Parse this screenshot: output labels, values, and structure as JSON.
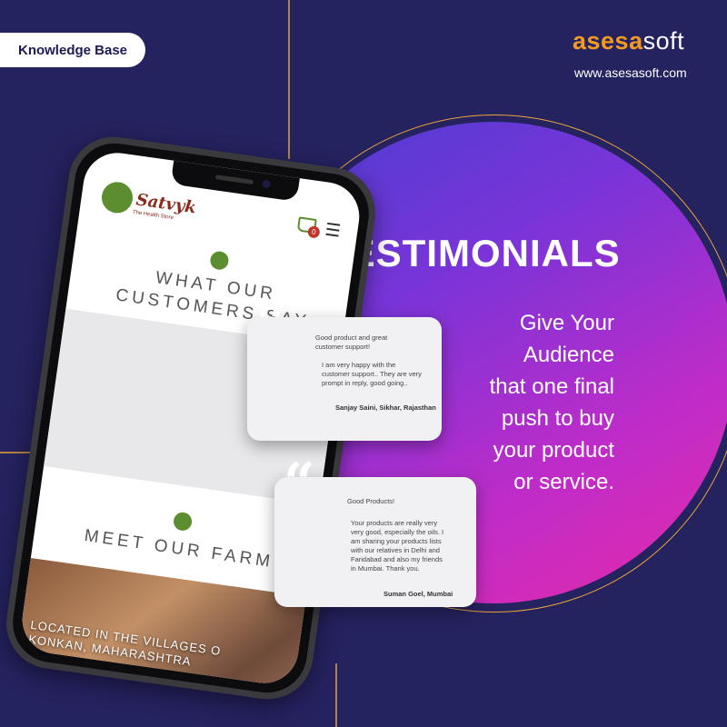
{
  "header": {
    "badge_label": "Knowledge Base",
    "logo_part1": "asesa",
    "logo_part2": "soft",
    "website": "www.asesasoft.com"
  },
  "hero": {
    "title": "TESTIMONIALS",
    "tagline_lines": [
      "Give Your",
      "Audience",
      "that one final",
      "push to buy",
      "your product",
      "or service."
    ]
  },
  "phone": {
    "brand_name": "Satvyk",
    "brand_subtitle": "The Health Store",
    "cart_count": "0",
    "section1_lines": [
      "WHAT OUR",
      "CUSTOMERS SAY"
    ],
    "section2_heading": "MEET OUR FARM",
    "photo_caption_lines": [
      "LOCATED IN THE VILLAGES O",
      "KONKAN, MAHARASHTRA"
    ]
  },
  "cards": [
    {
      "title_lines": [
        "Good product and great",
        "customer support!"
      ],
      "body_lines": [
        "I am very happy with the",
        "customer support.. They are very",
        "prompt in reply, good going.."
      ],
      "author": "Sanjay Saini, Sikhar, Rajasthan"
    },
    {
      "title_lines": [
        "Good Products!"
      ],
      "body_lines": [
        "Your products are really very",
        "very good, especially the oils. I",
        "am sharing your products lists",
        "with our relatives in Delhi and",
        "Faridabad and also my friends",
        "in Mumbai. Thank you."
      ],
      "author": "Suman Goel, Mumbai"
    }
  ],
  "colors": {
    "background": "#252260",
    "accent_orange": "#f39a22",
    "circle_gradient": [
      "#4a3ed0",
      "#e62aa8"
    ]
  }
}
